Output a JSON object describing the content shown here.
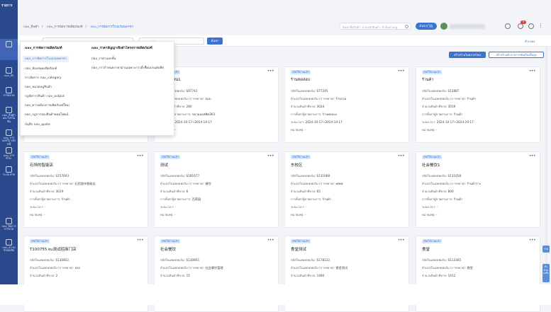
{
  "rail": {
    "logo": "รายการ",
    "items": [
      {
        "label": ""
      },
      {
        "label": "nav_สั่ง"
      },
      {
        "label": "การตลาด"
      },
      {
        "label": "nav_สินค้าและโปรโมชั่น"
      },
      {
        "label": "nav_การ ออกใบ แจ้งหนี้"
      },
      {
        "label": "nav_การ ชำระ"
      },
      {
        "label": "ระบบ ฝ่าย"
      },
      {
        "label": "nav_จัดการ การขาย"
      },
      {
        "label": "nav_ความ ช่วยเหลือ"
      }
    ]
  },
  "breadcrumb": [
    "nav_สินค้า",
    "nav_การจัดการผลิตภัณฑ์",
    "nav_การจัดการโรงแรมพลาซ่า"
  ],
  "topbar": {
    "search_placeholder": "ค้นหาชื่อสินค้า, ตามรหัสสินค้า, คำค้นหาเมนู",
    "button": "ค้นหา门店",
    "notif_count": "9"
  },
  "filters": {
    "input1": "",
    "input2": "ค้นหาชื่อในตลาด",
    "search_btn": "ค้นหา",
    "more": "ตัวกรอง"
  },
  "actions": {
    "primary": "สร้างร้านในตลาดใหม่",
    "secondary": "สร้างร้านค้าจากการจัดเรียงขั้นสูง"
  },
  "dropdown": {
    "col1_head": "nav_การจัดการผลิตภัณฑ์",
    "col2_head": "nav_ราคาสัญญาเชิงดำโครงการผลิตภัณฑ์",
    "col1_items": [
      "nav_การจัดการโรงแรมพลาซ่า",
      "nav_ห้องสมุดผลิตภัณฑ์",
      "การจัดการ nav_category",
      "nav_หมวดหมู่สินค้า",
      "กฎจัดการสินค้า nav_output",
      "nav_ความต้องการผลิตภัณฑ์ใหม่",
      "nav_กฎการจองสินค้าคอมโพ่นน์",
      "บันทึก nav_quote"
    ],
    "col2_items": [
      "nav_ราคาแยกชั้น",
      "nav_การกำหนดราคาผ่านเฉพาะการตั้งชื่อแบรนด์ผลิต"
    ]
  },
  "card_labels": {
    "tag": "เปิดใช้งานแล้ว",
    "code": "รหัสในแพลตฟอร์ม:",
    "owner": "ตัวแปรในแพลตฟอร์ม (การขยาย):",
    "count": "จำนวนสินค้าที่ขาย:",
    "contact": "การตั้งค่าผู้ขายผ่านการ:",
    "period": "ระยะเวลา:",
    "remark": "หมายเหตุ:"
  },
  "cards": [
    {
      "title": "",
      "code": "",
      "owner": "",
      "count": "",
      "contact": "",
      "period": "",
      "remark": ""
    },
    {
      "title": "…ศูนย์-สน1",
      "code": "S97741",
      "owner": "ธนบ",
      "count": "280",
      "contact": "ขนาดออฟฟิศ363",
      "period": "2024-10-17~2024-10-17",
      "remark": "-"
    },
    {
      "title": "ร้านทดสอบ",
      "code": "S77245",
      "owner": "ร้านรวม",
      "count": "3024",
      "contact": "ร้านทดลอง",
      "period": "2024-10-17~2024-10-17",
      "remark": "-"
    },
    {
      "title": "ร้านค้า",
      "code": "S13887",
      "owner": "ร้านค้า",
      "count": "3019",
      "contact": "ร้านค้า",
      "period": "2024-10-17~2024-10-17",
      "remark": "-"
    },
    {
      "title": "石恒的智能店",
      "code": "S157693",
      "owner": "石恒超市智能店",
      "count": "3019",
      "contact": "ร้านค้า",
      "period": "-",
      "remark": "-"
    },
    {
      "title": "测试",
      "code": "S181677",
      "owner": "餐饮",
      "count": "6",
      "contact": "百莉园",
      "period": "-",
      "remark": "-"
    },
    {
      "title": "东校区",
      "code": "S131068",
      "owner": "www",
      "count": "65",
      "contact": "ร้านค้า",
      "period": "-",
      "remark": "-"
    },
    {
      "title": "社会餐饮1",
      "code": "S131058",
      "owner": "ร้านค้าว่าง",
      "count": "800",
      "contact": "ร้านค้า",
      "period": "-",
      "remark": "-"
    },
    {
      "title": "T100755 ku测试招商门店",
      "code": "S130852",
      "owner": "xxx",
      "count": "2",
      "contact": "",
      "period": "",
      "remark": ""
    },
    {
      "title": "社会餐饮",
      "code": "S130851",
      "owner": "社会餐饮管理",
      "count": "15",
      "contact": "",
      "period": "",
      "remark": ""
    },
    {
      "title": "食堂测试",
      "code": "S178122",
      "owner": "食堂测试",
      "count": "1484",
      "contact": "",
      "period": "",
      "remark": ""
    },
    {
      "title": "食堂",
      "code": "S113305",
      "owner": "食堂",
      "count": "1412",
      "contact": "",
      "period": "",
      "remark": ""
    }
  ],
  "side_tabs": [
    "ราย",
    "ตัว ช่วย เหลือ"
  ],
  "colors": {
    "rail": "#2b4a8e",
    "accent": "#3b73d1",
    "tag_bg": "#d6e6fb"
  }
}
